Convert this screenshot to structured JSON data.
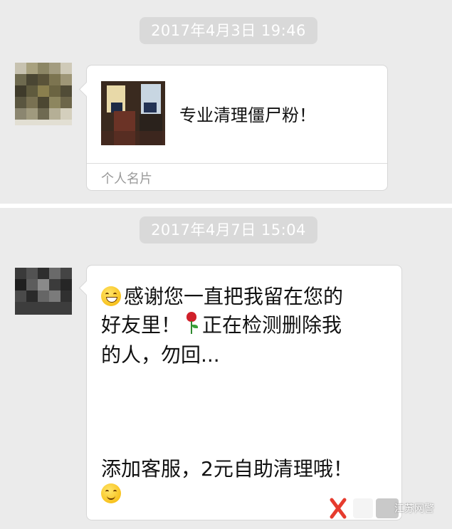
{
  "chat": {
    "messages": [
      {
        "timestamp": "2017年4月3日 19:46",
        "card": {
          "name": "专业清理僵尸粉！",
          "type_label": "个人名片"
        }
      },
      {
        "timestamp": "2017年4月7日 15:04",
        "lines": [
          "感谢您一直把我留在您的",
          "好友里！",
          "正在检测删除我",
          "的人，勿回...",
          "添加客服，2元自助清理哦！"
        ],
        "emojis": [
          "grinning-face-icon",
          "rose-icon",
          "smiling-face-icon"
        ]
      }
    ]
  },
  "watermark": {
    "text": "江苏网警",
    "logo_label": "X鲤鱼"
  },
  "colors": {
    "background": "#ebebeb",
    "bubble": "#ffffff",
    "timestamp_bg": "#d9d9d9",
    "text": "#111111"
  }
}
